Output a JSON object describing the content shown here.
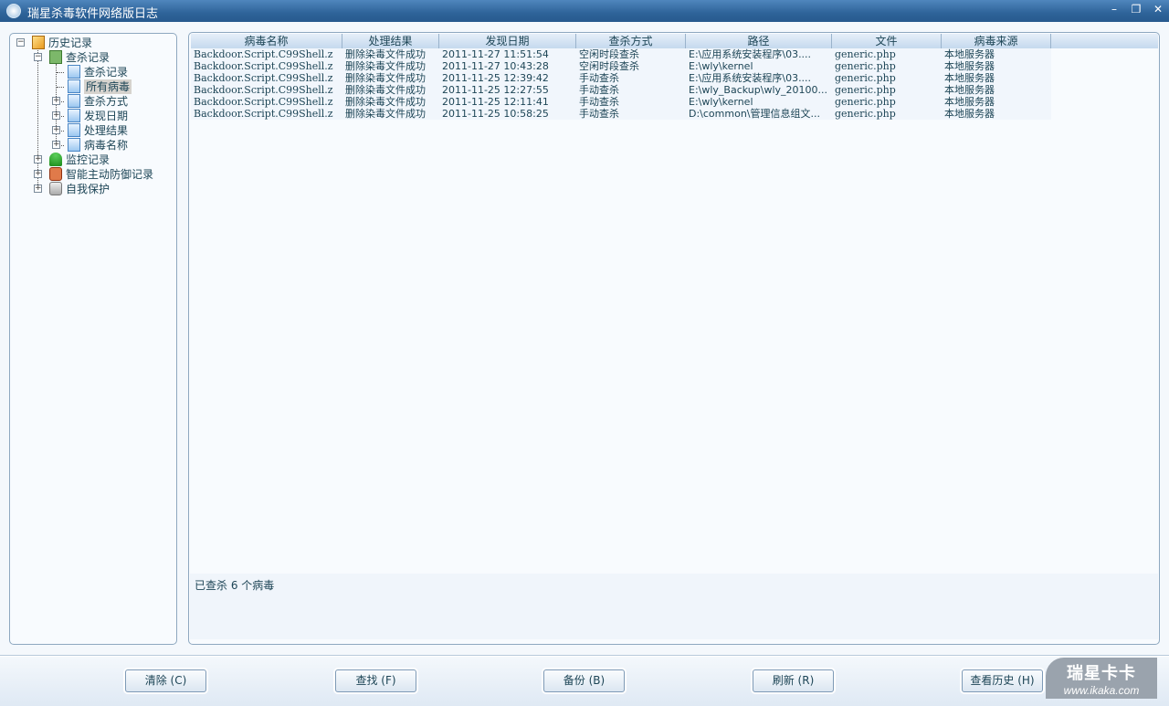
{
  "window": {
    "title": "瑞星杀毒软件网络版日志",
    "minimize": "–",
    "restore": "❐",
    "close": "✕"
  },
  "tree": {
    "root": "历史记录",
    "scan": "查杀记录",
    "scan_children": [
      "查杀记录",
      "所有病毒",
      "查杀方式",
      "发现日期",
      "处理结果",
      "病毒名称"
    ],
    "monitor": "监控记录",
    "defense": "智能主动防御记录",
    "protect": "自我保护",
    "selected": "所有病毒"
  },
  "table": {
    "columns": [
      "病毒名称",
      "处理结果",
      "发现日期",
      "查杀方式",
      "路径",
      "文件",
      "病毒来源"
    ],
    "rows": [
      [
        "Backdoor.Script.C99Shell.z",
        "删除染毒文件成功",
        "2011-11-27 11:51:54",
        "空闲时段查杀",
        "E:\\应用系统安装程序\\03....",
        "generic.php",
        "本地服务器"
      ],
      [
        "Backdoor.Script.C99Shell.z",
        "删除染毒文件成功",
        "2011-11-27 10:43:28",
        "空闲时段查杀",
        "E:\\wly\\kernel",
        "generic.php",
        "本地服务器"
      ],
      [
        "Backdoor.Script.C99Shell.z",
        "删除染毒文件成功",
        "2011-11-25 12:39:42",
        "手动查杀",
        "E:\\应用系统安装程序\\03....",
        "generic.php",
        "本地服务器"
      ],
      [
        "Backdoor.Script.C99Shell.z",
        "删除染毒文件成功",
        "2011-11-25 12:27:55",
        "手动查杀",
        "E:\\wly_Backup\\wly_20100...",
        "generic.php",
        "本地服务器"
      ],
      [
        "Backdoor.Script.C99Shell.z",
        "删除染毒文件成功",
        "2011-11-25 12:11:41",
        "手动查杀",
        "E:\\wly\\kernel",
        "generic.php",
        "本地服务器"
      ],
      [
        "Backdoor.Script.C99Shell.z",
        "删除染毒文件成功",
        "2011-11-25 10:58:25",
        "手动查杀",
        "D:\\common\\管理信息组文...",
        "generic.php",
        "本地服务器"
      ]
    ]
  },
  "status": "已查杀 6 个病毒",
  "buttons": [
    "清除 (C)",
    "查找 (F)",
    "备份 (B)",
    "刷新 (R)",
    "查看历史 (H)"
  ],
  "logo": {
    "name": "瑞星卡卡",
    "url": "www.ikaka.com"
  }
}
